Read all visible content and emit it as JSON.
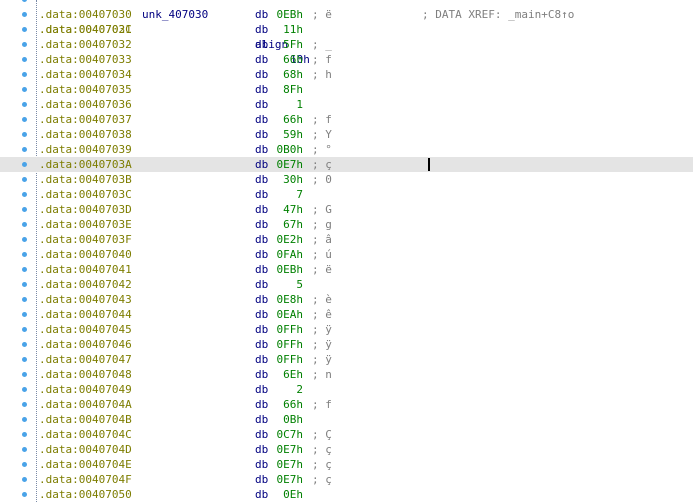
{
  "top_partial": {
    "address": ".data:0040702C",
    "mnemonic": "align",
    "operand": "10h"
  },
  "rows": [
    {
      "address": ".data:00407030",
      "label": "unk_407030",
      "mnemonic": "db",
      "operand": "0EBh",
      "comment": "; ë",
      "xref": "; DATA XREF: _main+C8↑o"
    },
    {
      "address": ".data:00407031",
      "label": "",
      "mnemonic": "db",
      "operand": "11h",
      "comment": "",
      "xref": ""
    },
    {
      "address": ".data:00407032",
      "label": "",
      "mnemonic": "db",
      "operand": "5Fh",
      "comment": "; _",
      "xref": ""
    },
    {
      "address": ".data:00407033",
      "label": "",
      "mnemonic": "db",
      "operand": "66h",
      "comment": "; f",
      "xref": ""
    },
    {
      "address": ".data:00407034",
      "label": "",
      "mnemonic": "db",
      "operand": "68h",
      "comment": "; h",
      "xref": ""
    },
    {
      "address": ".data:00407035",
      "label": "",
      "mnemonic": "db",
      "operand": "8Fh",
      "comment": "",
      "xref": ""
    },
    {
      "address": ".data:00407036",
      "label": "",
      "mnemonic": "db",
      "operand": "1",
      "comment": "",
      "xref": ""
    },
    {
      "address": ".data:00407037",
      "label": "",
      "mnemonic": "db",
      "operand": "66h",
      "comment": "; f",
      "xref": ""
    },
    {
      "address": ".data:00407038",
      "label": "",
      "mnemonic": "db",
      "operand": "59h",
      "comment": "; Y",
      "xref": ""
    },
    {
      "address": ".data:00407039",
      "label": "",
      "mnemonic": "db",
      "operand": "0B0h",
      "comment": "; °",
      "xref": ""
    },
    {
      "address": ".data:0040703A",
      "label": "",
      "mnemonic": "db",
      "operand": "0E7h",
      "comment": "; ç",
      "xref": "",
      "selected": true
    },
    {
      "address": ".data:0040703B",
      "label": "",
      "mnemonic": "db",
      "operand": "30h",
      "comment": "; 0",
      "xref": ""
    },
    {
      "address": ".data:0040703C",
      "label": "",
      "mnemonic": "db",
      "operand": "7",
      "comment": "",
      "xref": ""
    },
    {
      "address": ".data:0040703D",
      "label": "",
      "mnemonic": "db",
      "operand": "47h",
      "comment": "; G",
      "xref": ""
    },
    {
      "address": ".data:0040703E",
      "label": "",
      "mnemonic": "db",
      "operand": "67h",
      "comment": "; g",
      "xref": ""
    },
    {
      "address": ".data:0040703F",
      "label": "",
      "mnemonic": "db",
      "operand": "0E2h",
      "comment": "; â",
      "xref": ""
    },
    {
      "address": ".data:00407040",
      "label": "",
      "mnemonic": "db",
      "operand": "0FAh",
      "comment": "; ú",
      "xref": ""
    },
    {
      "address": ".data:00407041",
      "label": "",
      "mnemonic": "db",
      "operand": "0EBh",
      "comment": "; ë",
      "xref": ""
    },
    {
      "address": ".data:00407042",
      "label": "",
      "mnemonic": "db",
      "operand": "5",
      "comment": "",
      "xref": ""
    },
    {
      "address": ".data:00407043",
      "label": "",
      "mnemonic": "db",
      "operand": "0E8h",
      "comment": "; è",
      "xref": ""
    },
    {
      "address": ".data:00407044",
      "label": "",
      "mnemonic": "db",
      "operand": "0EAh",
      "comment": "; ê",
      "xref": ""
    },
    {
      "address": ".data:00407045",
      "label": "",
      "mnemonic": "db",
      "operand": "0FFh",
      "comment": "; ÿ",
      "xref": ""
    },
    {
      "address": ".data:00407046",
      "label": "",
      "mnemonic": "db",
      "operand": "0FFh",
      "comment": "; ÿ",
      "xref": ""
    },
    {
      "address": ".data:00407047",
      "label": "",
      "mnemonic": "db",
      "operand": "0FFh",
      "comment": "; ÿ",
      "xref": ""
    },
    {
      "address": ".data:00407048",
      "label": "",
      "mnemonic": "db",
      "operand": "6Eh",
      "comment": "; n",
      "xref": ""
    },
    {
      "address": ".data:00407049",
      "label": "",
      "mnemonic": "db",
      "operand": "2",
      "comment": "",
      "xref": ""
    },
    {
      "address": ".data:0040704A",
      "label": "",
      "mnemonic": "db",
      "operand": "66h",
      "comment": "; f",
      "xref": ""
    },
    {
      "address": ".data:0040704B",
      "label": "",
      "mnemonic": "db",
      "operand": "0Bh",
      "comment": "",
      "xref": ""
    },
    {
      "address": ".data:0040704C",
      "label": "",
      "mnemonic": "db",
      "operand": "0C7h",
      "comment": "; Ç",
      "xref": ""
    },
    {
      "address": ".data:0040704D",
      "label": "",
      "mnemonic": "db",
      "operand": "0E7h",
      "comment": "; ç",
      "xref": ""
    },
    {
      "address": ".data:0040704E",
      "label": "",
      "mnemonic": "db",
      "operand": "0E7h",
      "comment": "; ç",
      "xref": ""
    },
    {
      "address": ".data:0040704F",
      "label": "",
      "mnemonic": "db",
      "operand": "0E7h",
      "comment": "; ç",
      "xref": ""
    },
    {
      "address": ".data:00407050",
      "label": "",
      "mnemonic": "db",
      "operand": "0Eh",
      "comment": "",
      "xref": ""
    }
  ],
  "colors": {
    "address": "#7d7d00",
    "selected_address": "#1f3ea8",
    "mnemonic": "#000080",
    "number": "#008000",
    "comment": "#7f7f7f",
    "highlight": "#e4e4e4",
    "bullet": "#4aa3e8"
  }
}
